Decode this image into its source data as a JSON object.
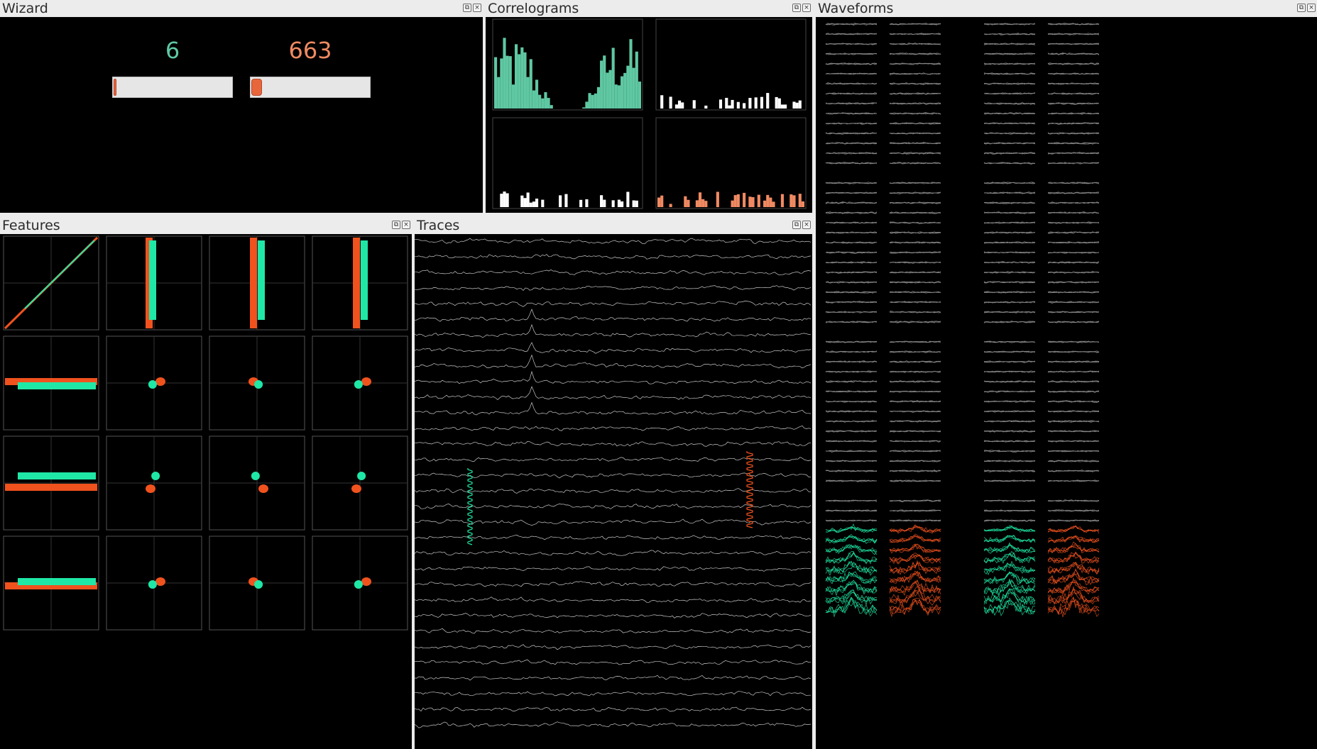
{
  "colors": {
    "cluster_a": "#5fc8a3",
    "cluster_a_bright": "#1fe8a6",
    "cluster_b": "#f08a62",
    "cluster_b_bright": "#f0521e",
    "trace": "#c8c8c8",
    "waveform_gray": "#8a8a8a"
  },
  "wizard": {
    "title": "Wizard",
    "best_cluster": "6",
    "match_cluster": "663",
    "best_slider_level": 0.0,
    "match_slider_level": 0.05
  },
  "correlograms": {
    "title": "Correlograms"
  },
  "waveforms": {
    "title": "Waveforms"
  },
  "features": {
    "title": "Features"
  },
  "traces": {
    "title": "Traces"
  },
  "dock_buttons": {
    "float_icon": "float-icon",
    "close_icon": "close-icon",
    "float_glyph": "⧉",
    "close_glyph": "×"
  }
}
